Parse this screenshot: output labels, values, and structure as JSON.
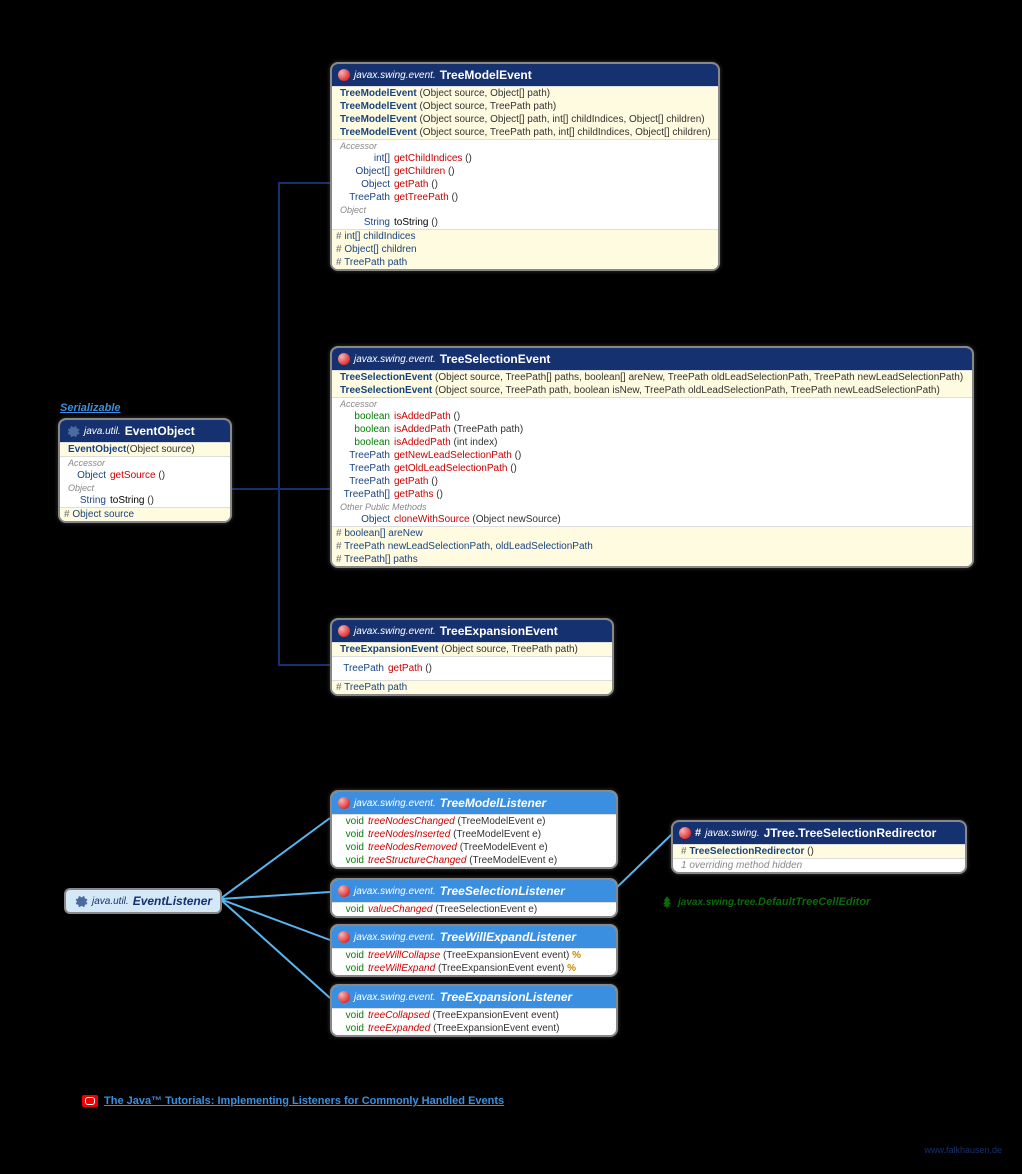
{
  "serializable_label": "Serializable",
  "eventobject": {
    "pkg": "java.util.",
    "cls": "EventObject",
    "ctor": "EventObject",
    "ctor_params": "(Object source)",
    "accessor_label": "Accessor",
    "m1_ret": "Object",
    "m1": "getSource",
    "m1_p": "()",
    "object_label": "Object",
    "m2_ret": "String",
    "m2": "toString",
    "m2_p": "()",
    "f1": "Object source"
  },
  "treemodelevent": {
    "pkg": "javax.swing.event.",
    "cls": "TreeModelEvent",
    "c1": "TreeModelEvent",
    "c1p": " (Object source, Object[] path)",
    "c2": "TreeModelEvent",
    "c2p": " (Object source, TreePath path)",
    "c3": "TreeModelEvent",
    "c3p": " (Object source, Object[] path, int[] childIndices, Object[] children)",
    "c4": "TreeModelEvent",
    "c4p": " (Object source, TreePath path, int[] childIndices, Object[] children)",
    "accessor_label": "Accessor",
    "m1r": "int[]",
    "m1": "getChildIndices",
    "m1p": "()",
    "m2r": "Object[]",
    "m2": "getChildren",
    "m2p": "()",
    "m3r": "Object",
    "m3": "getPath",
    "m3p": "()",
    "m4r": "TreePath",
    "m4": "getTreePath",
    "m4p": "()",
    "object_label": "Object",
    "m5r": "String",
    "m5": "toString",
    "m5p": "()",
    "f1": "int[] childIndices",
    "f2": "Object[] children",
    "f3": "TreePath path"
  },
  "treeselectionevent": {
    "pkg": "javax.swing.event.",
    "cls": "TreeSelectionEvent",
    "c1": "TreeSelectionEvent",
    "c1p": " (Object source, TreePath[] paths, boolean[] areNew, TreePath oldLeadSelectionPath, TreePath newLeadSelectionPath)",
    "c2": "TreeSelectionEvent",
    "c2p": " (Object source, TreePath path, boolean isNew, TreePath oldLeadSelectionPath, TreePath newLeadSelectionPath)",
    "accessor_label": "Accessor",
    "m1r": "boolean",
    "m1": "isAddedPath",
    "m1p": "()",
    "m2r": "boolean",
    "m2": "isAddedPath",
    "m2p": "(TreePath path)",
    "m3r": "boolean",
    "m3": "isAddedPath",
    "m3p": "(int index)",
    "m4r": "TreePath",
    "m4": "getNewLeadSelectionPath",
    "m4p": "()",
    "m5r": "TreePath",
    "m5": "getOldLeadSelectionPath",
    "m5p": "()",
    "m6r": "TreePath",
    "m6": "getPath",
    "m6p": "()",
    "m7r": "TreePath[]",
    "m7": "getPaths",
    "m7p": "()",
    "other_label": "Other Public Methods",
    "m8r": "Object",
    "m8": "cloneWithSource",
    "m8p": "(Object newSource)",
    "f1": "boolean[] areNew",
    "f2": "TreePath newLeadSelectionPath, oldLeadSelectionPath",
    "f3": "TreePath[] paths"
  },
  "treeexpansionevent": {
    "pkg": "javax.swing.event.",
    "cls": "TreeExpansionEvent",
    "c1": "TreeExpansionEvent",
    "c1p": " (Object source, TreePath path)",
    "m1r": "TreePath",
    "m1": "getPath",
    "m1p": "()",
    "f1": "TreePath path"
  },
  "eventlistener": {
    "pkg": "java.util.",
    "cls": "EventListener"
  },
  "treemodellistener": {
    "pkg": "javax.swing.event.",
    "cls": "TreeModelListener",
    "m1r": "void",
    "m1": "treeNodesChanged",
    "m1p": "(TreeModelEvent e)",
    "m2r": "void",
    "m2": "treeNodesInserted",
    "m2p": "(TreeModelEvent e)",
    "m3r": "void",
    "m3": "treeNodesRemoved",
    "m3p": "(TreeModelEvent e)",
    "m4r": "void",
    "m4": "treeStructureChanged",
    "m4p": "(TreeModelEvent e)"
  },
  "treeselectionlistener": {
    "pkg": "javax.swing.event.",
    "cls": "TreeSelectionListener",
    "m1r": "void",
    "m1": "valueChanged",
    "m1p": "(TreeSelectionEvent e)"
  },
  "treewillexpandlistener": {
    "pkg": "javax.swing.event.",
    "cls": "TreeWillExpandListener",
    "m1r": "void",
    "m1": "treeWillCollapse",
    "m1p": "(TreeExpansionEvent event) ",
    "m2r": "void",
    "m2": "treeWillExpand",
    "m2p": "(TreeExpansionEvent event) "
  },
  "treeexpansionlistener": {
    "pkg": "javax.swing.event.",
    "cls": "TreeExpansionListener",
    "m1r": "void",
    "m1": "treeCollapsed",
    "m1p": "(TreeExpansionEvent event)",
    "m2r": "void",
    "m2": "treeExpanded",
    "m2p": "(TreeExpansionEvent event)"
  },
  "redirector": {
    "pkg": "javax.swing.",
    "cls": "JTree.TreeSelectionRedirector",
    "c1": "TreeSelectionRedirector",
    "c1p": " ()",
    "note": "1 overriding method hidden"
  },
  "defaulttreecelledit": {
    "pkg": "javax.swing.tree.",
    "cls": "DefaultTreeCellEditor"
  },
  "footer": {
    "text": "The Java™ Tutorials: Implementing Listeners for Commonly Handled Events"
  },
  "watermark": "www.falkhausen.de",
  "hash": "#",
  "pct": "%"
}
